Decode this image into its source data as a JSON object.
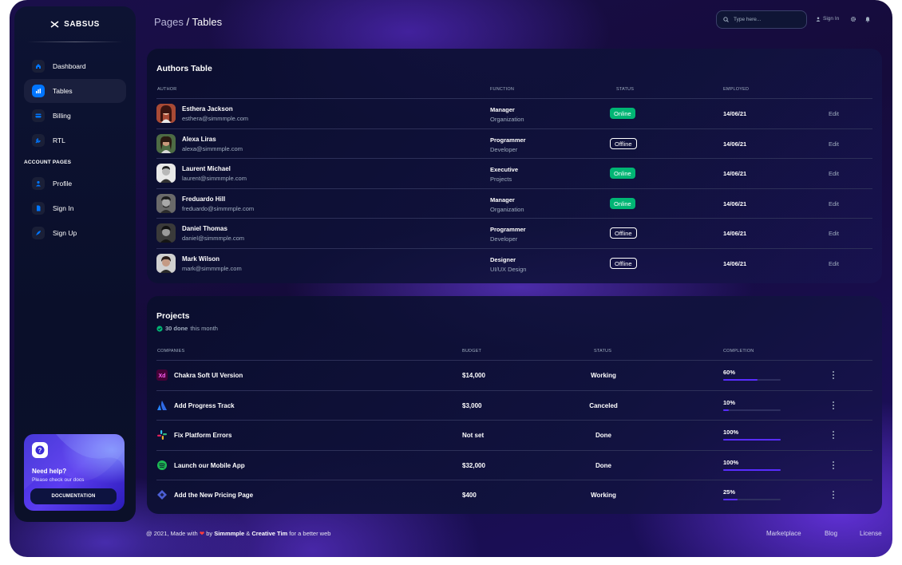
{
  "brand": {
    "name": "SABSUS"
  },
  "header": {
    "crumb_root": "Pages",
    "crumb_sep": " / ",
    "crumb_current": "Tables",
    "search_placeholder": "Type here...",
    "sign_in": "Sign In"
  },
  "sidebar": {
    "items": [
      {
        "label": "Dashboard",
        "icon": "home-icon"
      },
      {
        "label": "Tables",
        "icon": "bar-chart-icon",
        "active": true
      },
      {
        "label": "Billing",
        "icon": "credit-card-icon"
      },
      {
        "label": "RTL",
        "icon": "wrench-icon"
      }
    ],
    "section_label": "ACCOUNT PAGES",
    "account_items": [
      {
        "label": "Profile",
        "icon": "person-icon"
      },
      {
        "label": "Sign In",
        "icon": "document-icon"
      },
      {
        "label": "Sign Up",
        "icon": "rocket-icon"
      }
    ],
    "help": {
      "title": "Need help?",
      "subtitle": "Please check our docs",
      "button": "DOCUMENTATION"
    }
  },
  "authors": {
    "title": "Authors Table",
    "columns": [
      "AUTHOR",
      "FUNCTION",
      "STATUS",
      "EMPLOYED"
    ],
    "rows": [
      {
        "name": "Esthera Jackson",
        "email": "esthera@simmmple.com",
        "role": "Manager",
        "dept": "Organization",
        "status": "Online",
        "employed": "14/06/21",
        "action": "Edit"
      },
      {
        "name": "Alexa Liras",
        "email": "alexa@simmmple.com",
        "role": "Programmer",
        "dept": "Developer",
        "status": "Offline",
        "employed": "14/06/21",
        "action": "Edit"
      },
      {
        "name": "Laurent Michael",
        "email": "laurent@simmmple.com",
        "role": "Executive",
        "dept": "Projects",
        "status": "Online",
        "employed": "14/06/21",
        "action": "Edit"
      },
      {
        "name": "Freduardo Hill",
        "email": "freduardo@simmmple.com",
        "role": "Manager",
        "dept": "Organization",
        "status": "Online",
        "employed": "14/06/21",
        "action": "Edit"
      },
      {
        "name": "Daniel Thomas",
        "email": "daniel@simmmple.com",
        "role": "Programmer",
        "dept": "Developer",
        "status": "Offline",
        "employed": "14/06/21",
        "action": "Edit"
      },
      {
        "name": "Mark Wilson",
        "email": "mark@simmmple.com",
        "role": "Designer",
        "dept": "UI/UX Design",
        "status": "Offline",
        "employed": "14/06/21",
        "action": "Edit"
      }
    ]
  },
  "projects": {
    "title": "Projects",
    "subtitle_bold": "30 done",
    "subtitle_rest": " this month",
    "columns": [
      "COMPANIES",
      "BUDGET",
      "STATUS",
      "COMPLETION"
    ],
    "rows": [
      {
        "name": "Chakra Soft UI Version",
        "icon": "xd-icon",
        "budget": "$14,000",
        "status": "Working",
        "completion": "60%",
        "progress": 0.6
      },
      {
        "name": "Add Progress Track",
        "icon": "atlassian-icon",
        "budget": "$3,000",
        "status": "Canceled",
        "completion": "10%",
        "progress": 0.1
      },
      {
        "name": "Fix Platform Errors",
        "icon": "slack-icon",
        "budget": "Not set",
        "status": "Done",
        "completion": "100%",
        "progress": 1.0
      },
      {
        "name": "Launch our Mobile App",
        "icon": "spotify-icon",
        "budget": "$32,000",
        "status": "Done",
        "completion": "100%",
        "progress": 1.0
      },
      {
        "name": "Add the New Pricing Page",
        "icon": "jira-icon",
        "budget": "$400",
        "status": "Working",
        "completion": "25%",
        "progress": 0.25
      }
    ]
  },
  "footer": {
    "prefix": "@ 2021, Made with ",
    "by": " by ",
    "author1": "Simmmple",
    "amp": " & ",
    "author2": "Creative Tim",
    "suffix": " for a better web",
    "links": [
      "Marketplace",
      "Blog",
      "License"
    ]
  },
  "colors": {
    "accent": "#582cff",
    "online": "#01b574",
    "active_icon": "#0075ff"
  }
}
